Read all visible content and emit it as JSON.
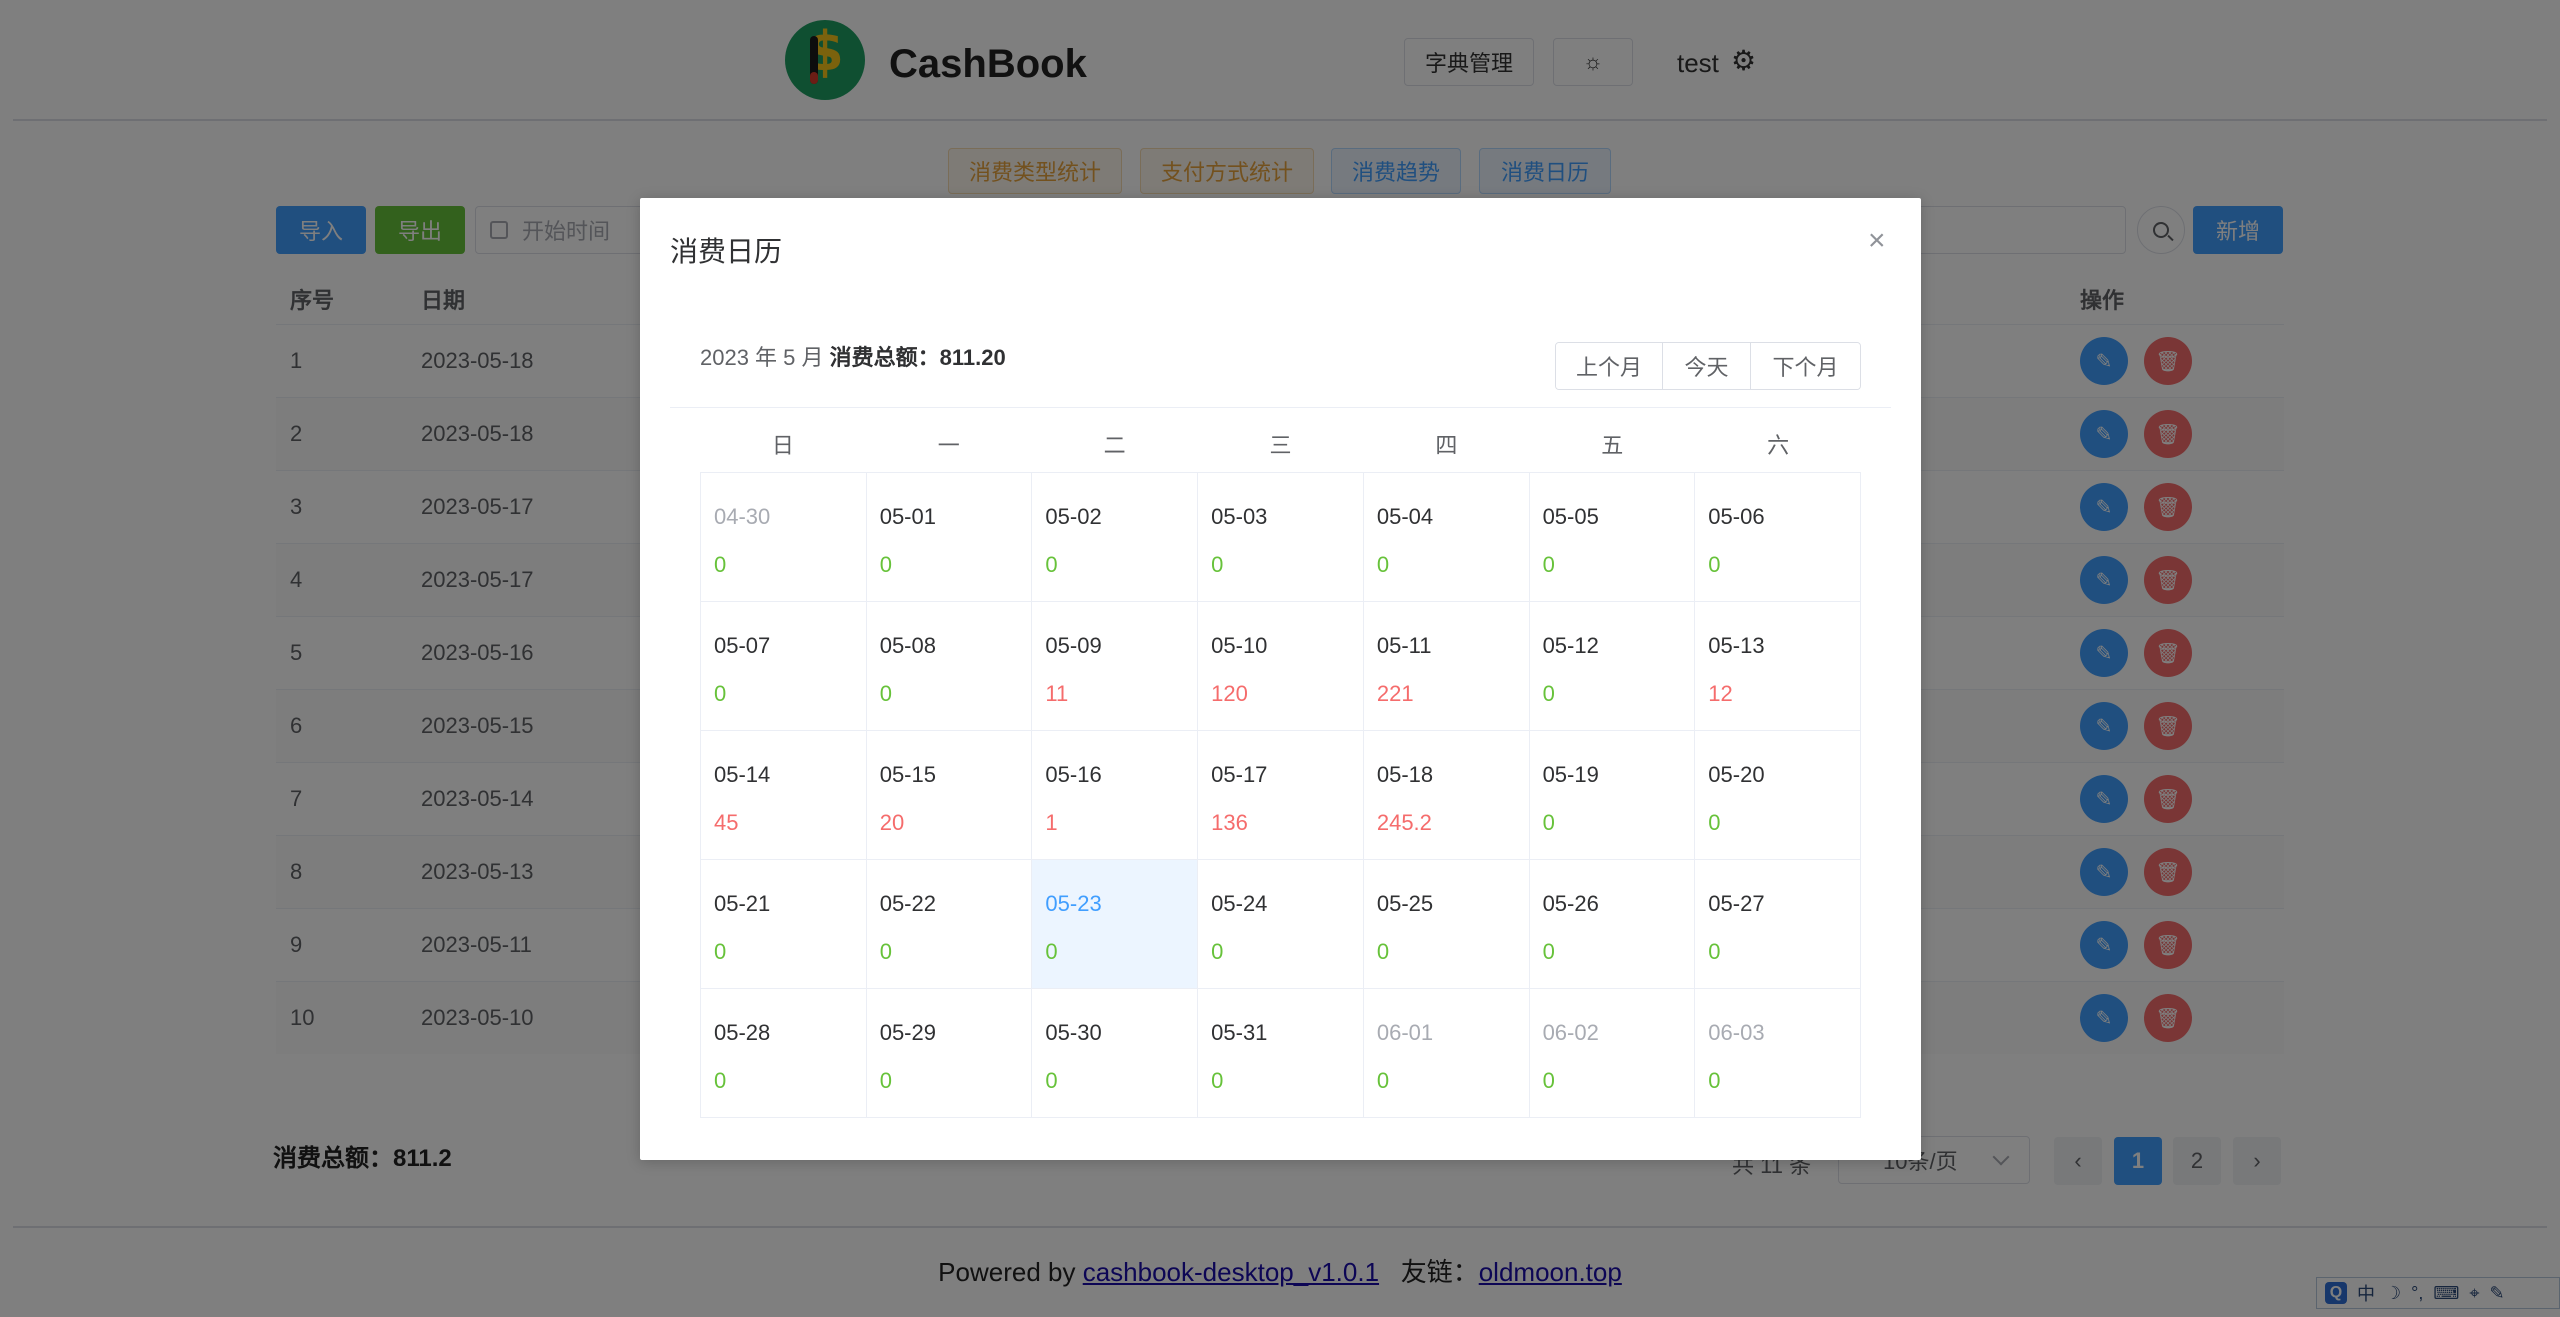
{
  "header": {
    "app_title": "CashBook",
    "dict_button": "字典管理",
    "user": "test"
  },
  "stats_tabs": [
    "消费类型统计",
    "支付方式统计",
    "消费趋势",
    "消费日历"
  ],
  "toolbar": {
    "import": "导入",
    "export": "导出",
    "start_date_placeholder": "开始时间",
    "add": "新增"
  },
  "table": {
    "headers": {
      "index": "序号",
      "date": "日期",
      "ops": "操作"
    },
    "rows": [
      {
        "index": "1",
        "date": "2023-05-18"
      },
      {
        "index": "2",
        "date": "2023-05-18"
      },
      {
        "index": "3",
        "date": "2023-05-17"
      },
      {
        "index": "4",
        "date": "2023-05-17"
      },
      {
        "index": "5",
        "date": "2023-05-16"
      },
      {
        "index": "6",
        "date": "2023-05-15"
      },
      {
        "index": "7",
        "date": "2023-05-14"
      },
      {
        "index": "8",
        "date": "2023-05-13"
      },
      {
        "index": "9",
        "date": "2023-05-11"
      },
      {
        "index": "10",
        "date": "2023-05-10"
      }
    ]
  },
  "summary": {
    "label": "消费总额：",
    "value": "811.2"
  },
  "pagination": {
    "total_text": "共 11 条",
    "page_size": "10条/页",
    "pages": [
      "1",
      "2"
    ],
    "active_page": "1"
  },
  "footer": {
    "powered_prefix": "Powered by",
    "powered_link": "cashbook-desktop_v1.0.1",
    "friend_label": "友链：",
    "friend_link": "oldmoon.top"
  },
  "ime": {
    "mode": "中"
  },
  "dialog": {
    "title": "消费日历",
    "month_label": "2023 年 5 月",
    "total_label": "消费总额：",
    "total_value": "811.20",
    "prev_month": "上个月",
    "today": "今天",
    "next_month": "下个月",
    "weekdays": [
      "日",
      "一",
      "二",
      "三",
      "四",
      "五",
      "六"
    ],
    "days": [
      {
        "date": "04-30",
        "amount": "0",
        "other": true
      },
      {
        "date": "05-01",
        "amount": "0"
      },
      {
        "date": "05-02",
        "amount": "0"
      },
      {
        "date": "05-03",
        "amount": "0"
      },
      {
        "date": "05-04",
        "amount": "0"
      },
      {
        "date": "05-05",
        "amount": "0"
      },
      {
        "date": "05-06",
        "amount": "0"
      },
      {
        "date": "05-07",
        "amount": "0"
      },
      {
        "date": "05-08",
        "amount": "0"
      },
      {
        "date": "05-09",
        "amount": "11"
      },
      {
        "date": "05-10",
        "amount": "120"
      },
      {
        "date": "05-11",
        "amount": "221"
      },
      {
        "date": "05-12",
        "amount": "0"
      },
      {
        "date": "05-13",
        "amount": "12"
      },
      {
        "date": "05-14",
        "amount": "45"
      },
      {
        "date": "05-15",
        "amount": "20"
      },
      {
        "date": "05-16",
        "amount": "1"
      },
      {
        "date": "05-17",
        "amount": "136"
      },
      {
        "date": "05-18",
        "amount": "245.2"
      },
      {
        "date": "05-19",
        "amount": "0"
      },
      {
        "date": "05-20",
        "amount": "0"
      },
      {
        "date": "05-21",
        "amount": "0"
      },
      {
        "date": "05-22",
        "amount": "0"
      },
      {
        "date": "05-23",
        "amount": "0",
        "today": true
      },
      {
        "date": "05-24",
        "amount": "0"
      },
      {
        "date": "05-25",
        "amount": "0"
      },
      {
        "date": "05-26",
        "amount": "0"
      },
      {
        "date": "05-27",
        "amount": "0"
      },
      {
        "date": "05-28",
        "amount": "0"
      },
      {
        "date": "05-29",
        "amount": "0"
      },
      {
        "date": "05-30",
        "amount": "0"
      },
      {
        "date": "05-31",
        "amount": "0"
      },
      {
        "date": "06-01",
        "amount": "0",
        "other": true
      },
      {
        "date": "06-02",
        "amount": "0",
        "other": true
      },
      {
        "date": "06-03",
        "amount": "0",
        "other": true
      }
    ]
  },
  "colors": {
    "primary": "#409eff",
    "success": "#67c23a",
    "danger": "#f56c6c",
    "warning": "#e6a23c"
  }
}
